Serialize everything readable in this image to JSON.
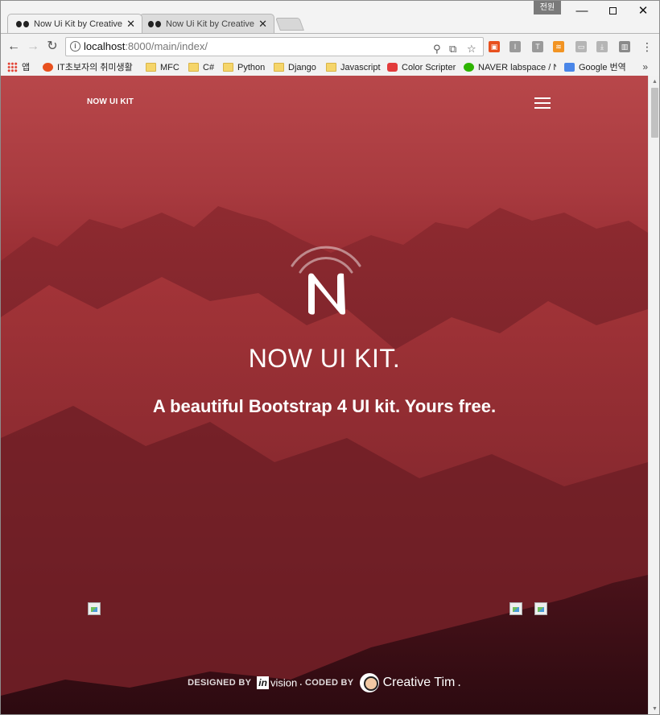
{
  "browser": {
    "tabs": [
      {
        "title": "Now Ui Kit by Creative T"
      },
      {
        "title": "Now Ui Kit by Creative T"
      }
    ],
    "user_badge": "전원",
    "url": {
      "host": "localhost",
      "path": ":8000/main/index/"
    },
    "bookmarks": [
      {
        "label": "앱",
        "icon": "apps-icon"
      },
      {
        "label": "IT초보자의 취미생활",
        "icon": "blog-icon"
      },
      {
        "label": "MFC",
        "icon": "folder-icon"
      },
      {
        "label": "C#",
        "icon": "folder-icon"
      },
      {
        "label": "Python",
        "icon": "folder-icon"
      },
      {
        "label": "Django",
        "icon": "folder-icon"
      },
      {
        "label": "Javascript",
        "icon": "folder-icon"
      },
      {
        "label": "Color Scripter",
        "icon": "color-scripter-icon"
      },
      {
        "label": "NAVER labspace / N",
        "icon": "naver-icon"
      },
      {
        "label": "Google 번역",
        "icon": "google-translate-icon"
      }
    ],
    "bookmarks_more": "»"
  },
  "page": {
    "brand": "NOW UI KIT",
    "title": "NOW UI KIT.",
    "subtitle": "A beautiful Bootstrap 4 UI kit. Yours free.",
    "footer": {
      "designed_by": "DESIGNED BY",
      "invision_mark": "in",
      "invision_word": "vision",
      "separator": ". CODED BY",
      "creative_tim": "Creative Tim",
      "end": "."
    }
  },
  "colors": {
    "hero_top": "#b8474a",
    "hero_bottom": "#3a1018",
    "accent": "#ffffff"
  }
}
